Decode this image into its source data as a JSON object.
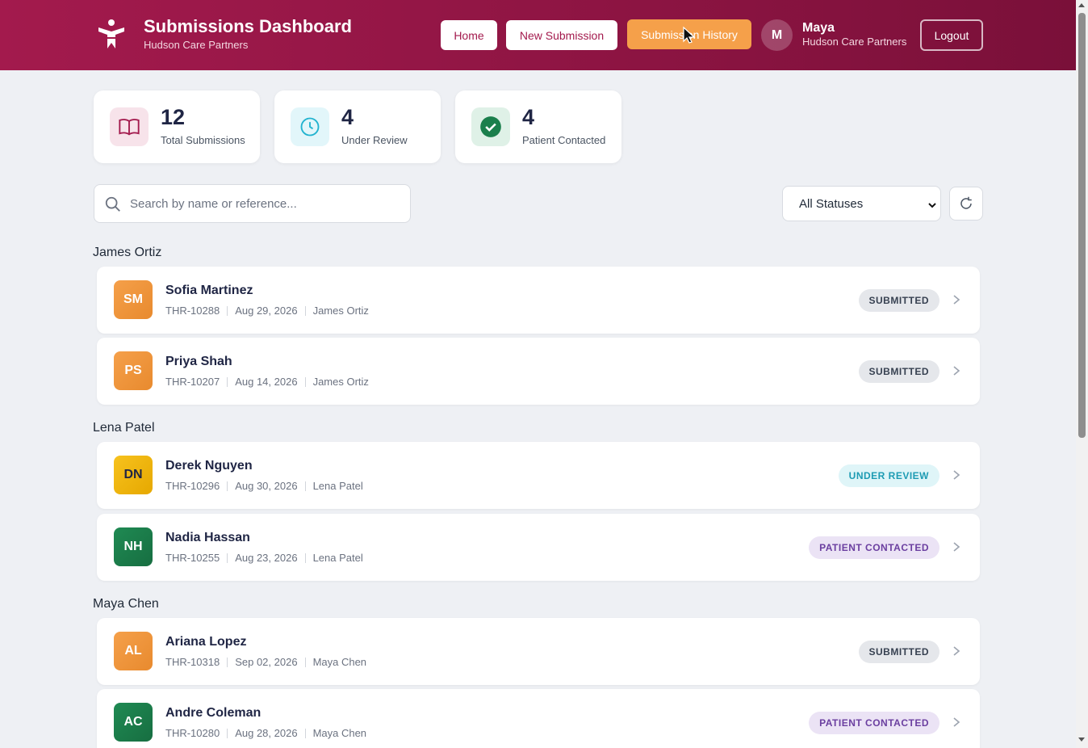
{
  "header": {
    "title": "Submissions Dashboard",
    "subtitle": "Hudson Care Partners",
    "nav": {
      "home": "Home",
      "new_submission": "New Submission",
      "submission_history": "Submission History"
    },
    "user": {
      "initial": "M",
      "name": "Maya",
      "org": "Hudson Care Partners"
    },
    "logout": "Logout",
    "colors": {
      "brand": "#a31a4d",
      "active_nav": "#f5a04a"
    }
  },
  "stats": [
    {
      "value": "12",
      "label": "Total Submissions",
      "icon": "book-icon"
    },
    {
      "value": "4",
      "label": "Under Review",
      "icon": "clock-icon"
    },
    {
      "value": "4",
      "label": "Patient Contacted",
      "icon": "check-circle-icon"
    }
  ],
  "search": {
    "placeholder": "Search by name or reference...",
    "value": ""
  },
  "filter": {
    "selected": "All Statuses"
  },
  "groups": [
    {
      "title": "James Ortiz",
      "items": [
        {
          "initials": "SM",
          "name": "Sofia Martinez",
          "ref": "THR-10288",
          "date": "Aug 29, 2026",
          "owner": "James Ortiz",
          "status": "SUBMITTED",
          "avatar_color": "#ef9636"
        },
        {
          "initials": "PS",
          "name": "Priya Shah",
          "ref": "THR-10207",
          "date": "Aug 14, 2026",
          "owner": "James Ortiz",
          "status": "SUBMITTED",
          "avatar_color": "#ef9636"
        }
      ]
    },
    {
      "title": "Lena Patel",
      "items": [
        {
          "initials": "DN",
          "name": "Derek Nguyen",
          "ref": "THR-10296",
          "date": "Aug 30, 2026",
          "owner": "Lena Patel",
          "status": "UNDER REVIEW",
          "avatar_color": "#f0b40d"
        },
        {
          "initials": "NH",
          "name": "Nadia Hassan",
          "ref": "THR-10255",
          "date": "Aug 23, 2026",
          "owner": "Lena Patel",
          "status": "PATIENT CONTACTED",
          "avatar_color": "#1b7f4c"
        }
      ]
    },
    {
      "title": "Maya Chen",
      "items": [
        {
          "initials": "AL",
          "name": "Ariana Lopez",
          "ref": "THR-10318",
          "date": "Sep 02, 2026",
          "owner": "Maya Chen",
          "status": "SUBMITTED",
          "avatar_color": "#ef9636"
        },
        {
          "initials": "AC",
          "name": "Andre Coleman",
          "ref": "THR-10280",
          "date": "Aug 28, 2026",
          "owner": "Maya Chen",
          "status": "PATIENT CONTACTED",
          "avatar_color": "#1b7f4c"
        }
      ]
    }
  ]
}
